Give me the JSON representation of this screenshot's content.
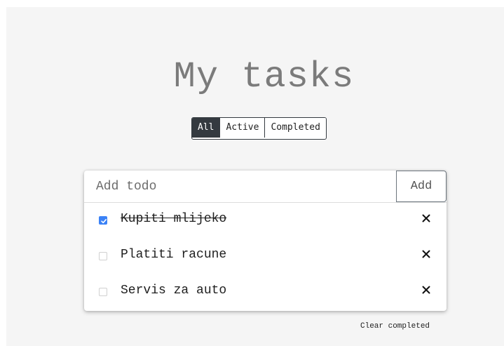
{
  "header": {
    "title": "My tasks"
  },
  "filters": {
    "items": [
      "All",
      "Active",
      "Completed"
    ],
    "selected": "All"
  },
  "add_todo": {
    "placeholder": "Add todo",
    "value": "",
    "button_label": "Add"
  },
  "todos": [
    {
      "text": "Kupiti mlijeko",
      "completed": true
    },
    {
      "text": "Platiti racune",
      "completed": false
    },
    {
      "text": "Servis za auto",
      "completed": false
    }
  ],
  "footer": {
    "clear_label": "Clear completed"
  },
  "icons": {
    "remove": "close-icon",
    "check": "checkmark-icon"
  },
  "colors": {
    "filter_active_bg": "#343a40",
    "checkbox_checked": "#3b82f6",
    "title": "#7b7b7b"
  }
}
